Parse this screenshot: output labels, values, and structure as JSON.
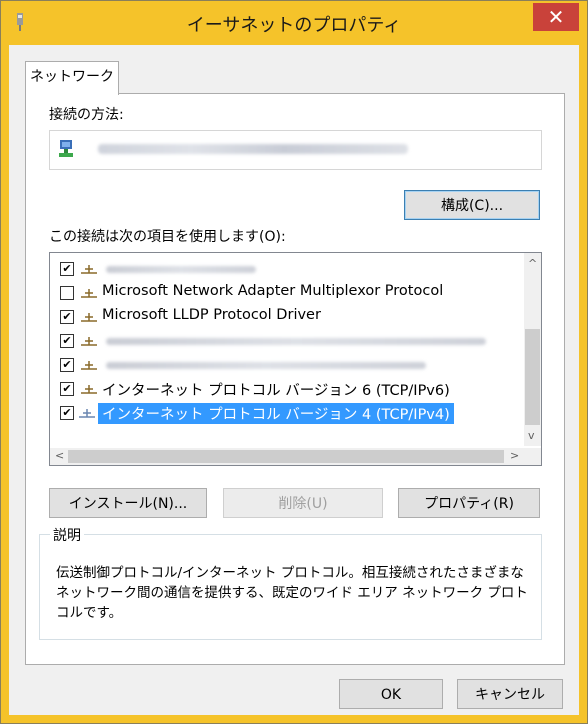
{
  "window": {
    "title": "イーサネットのプロパティ",
    "close_glyph": "✕",
    "accent": "#f5c32a"
  },
  "tabs": [
    {
      "label": "ネットワーク"
    }
  ],
  "connection": {
    "label": "接続の方法:",
    "configure_button": "構成(C)..."
  },
  "items_label": "この接続は次の項目を使用します(O):",
  "items": [
    {
      "label": "",
      "checked": true
    },
    {
      "label": "Microsoft Network Adapter Multiplexor Protocol",
      "checked": false
    },
    {
      "label": "Microsoft LLDP Protocol Driver",
      "checked": true
    },
    {
      "label": "",
      "checked": true
    },
    {
      "label": "",
      "checked": true
    },
    {
      "label": "インターネット プロトコル バージョン 6 (TCP/IPv6)",
      "checked": true
    },
    {
      "label": "インターネット プロトコル バージョン 4 (TCP/IPv4)",
      "checked": true,
      "selected": true
    }
  ],
  "buttons": {
    "install": "インストール(N)...",
    "uninstall": "削除(U)",
    "properties": "プロパティ(R)",
    "ok": "OK",
    "cancel": "キャンセル"
  },
  "description": {
    "title": "説明",
    "text": "伝送制御プロトコル/インターネット プロトコル。相互接続されたさまざまなネットワーク間の通信を提供する、既定のワイド エリア ネットワーク プロトコルです。"
  },
  "scroll": {
    "up": "^",
    "down": "v",
    "left": "<",
    "right": ">"
  },
  "checkmark": "✔"
}
